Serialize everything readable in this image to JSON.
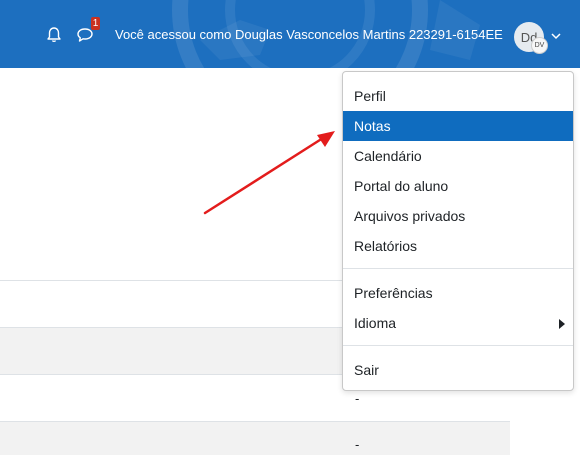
{
  "header": {
    "login_info": "Você acessou como Douglas Vasconcelos Martins 223291-6154EE",
    "message_count": "1",
    "icons": {
      "notifications": "bell-icon",
      "messages": "chat-icon",
      "user_menu": "chevron-down-icon"
    },
    "avatar": {
      "initials": "Dd",
      "badge": "DV"
    }
  },
  "user_menu": {
    "items": [
      {
        "label": "Perfil"
      },
      {
        "label": "Notas",
        "active": true
      },
      {
        "label": "Calendário"
      },
      {
        "label": "Portal do aluno"
      },
      {
        "label": "Arquivos privados"
      },
      {
        "label": "Relatórios"
      }
    ],
    "items_2": [
      {
        "label": "Preferências"
      },
      {
        "label": "Idioma",
        "has_submenu": true
      }
    ],
    "items_3": [
      {
        "label": "Sair"
      }
    ]
  },
  "table": {
    "cells": [
      "-",
      "-"
    ]
  },
  "colors": {
    "navbar": "#1d6fbf",
    "active_item": "#0f6cbf",
    "annotation_arrow": "#e31c1c",
    "badge": "#ca3120"
  }
}
